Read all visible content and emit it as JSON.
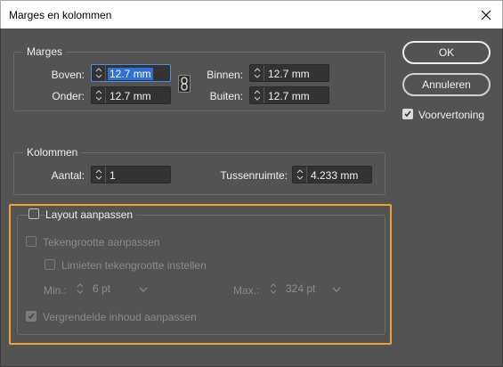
{
  "window": {
    "title": "Marges en kolommen"
  },
  "marges": {
    "legend": "Marges",
    "boven_label": "Boven:",
    "boven_value": "12.7 mm",
    "onder_label": "Onder:",
    "onder_value": "12.7 mm",
    "binnen_label": "Binnen:",
    "binnen_value": "12.7 mm",
    "buiten_label": "Buiten:",
    "buiten_value": "12.7 mm"
  },
  "kolommen": {
    "legend": "Kolommen",
    "aantal_label": "Aantal:",
    "aantal_value": "1",
    "tussenruimte_label": "Tussenruimte:",
    "tussenruimte_value": "4.233 mm"
  },
  "layout": {
    "checkbox_label": "Layout aanpassen",
    "checked": false,
    "tekengrootte_label": "Tekengrootte aanpassen",
    "limieten_label": "Limieten tekengrootte instellen",
    "min_label": "Min.:",
    "min_value": "6 pt",
    "max_label": "Max.:",
    "max_value": "324 pt",
    "vergrendelde_label": "Vergrendelde inhoud aanpassen"
  },
  "buttons": {
    "ok": "OK",
    "annuleren": "Annuleren"
  },
  "voorvertoning": {
    "label": "Voorvertoning",
    "checked": true
  },
  "colors": {
    "dialog_bg": "#535353",
    "highlight": "#f0a030",
    "selection": "#2f6fd6"
  }
}
